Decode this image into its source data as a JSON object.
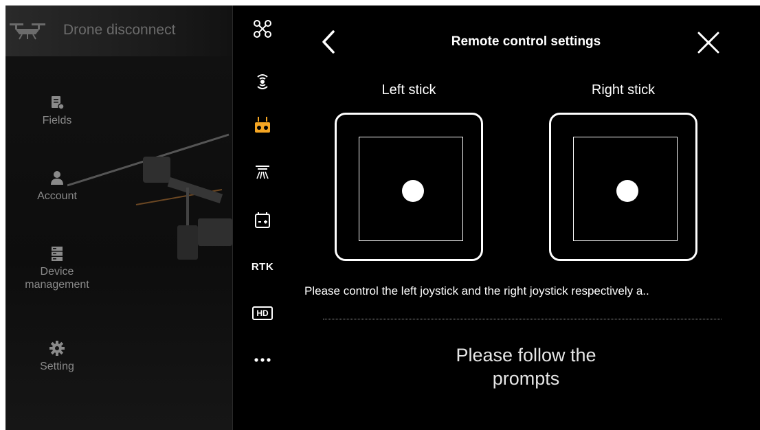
{
  "status": {
    "text": "Drone disconnect",
    "icon": "drone-icon"
  },
  "nav": {
    "items": [
      {
        "label": "Fields",
        "icon": "fields-icon"
      },
      {
        "label": "Account",
        "icon": "account-icon"
      },
      {
        "label": "Device\nmanagement",
        "icon": "device-icon"
      },
      {
        "label": "Setting",
        "icon": "gear-icon"
      }
    ]
  },
  "iconbar": {
    "items": [
      {
        "name": "aircraft-icon"
      },
      {
        "name": "signal-icon"
      },
      {
        "name": "remote-controller-icon",
        "active": true
      },
      {
        "name": "spray-icon"
      },
      {
        "name": "battery-icon"
      },
      {
        "name": "rtk",
        "label": "RTK"
      },
      {
        "name": "hd-icon",
        "label": "HD"
      },
      {
        "name": "more-icon"
      }
    ],
    "accent": "#f5a623"
  },
  "dialog": {
    "title": "Remote control settings",
    "left_stick": "Left stick",
    "right_stick": "Right stick",
    "instruction": "Please control the left joystick and the right joystick respectively a..",
    "prompt": "Please follow the prompts"
  }
}
